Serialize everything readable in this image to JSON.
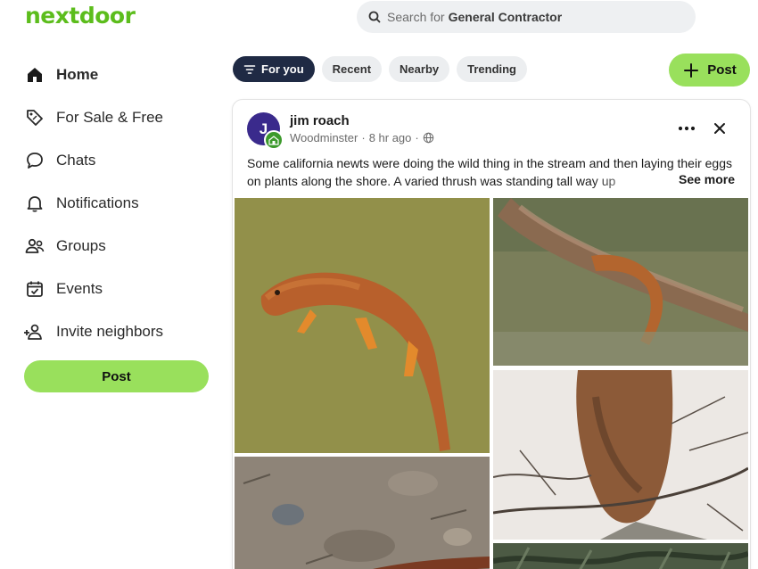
{
  "app": {
    "logo": "nextdoor",
    "brand_color": "#5cbd1c",
    "accent_color": "#99e05c"
  },
  "search": {
    "prefix": "Search for",
    "term": "General Contractor"
  },
  "sidebar": {
    "items": [
      {
        "label": "Home",
        "icon": "home-icon",
        "active": true
      },
      {
        "label": "For Sale & Free",
        "icon": "tag-icon"
      },
      {
        "label": "Chats",
        "icon": "chat-bubble-icon"
      },
      {
        "label": "Notifications",
        "icon": "bell-icon"
      },
      {
        "label": "Groups",
        "icon": "people-icon"
      },
      {
        "label": "Events",
        "icon": "calendar-icon"
      },
      {
        "label": "Invite neighbors",
        "icon": "add-person-icon"
      }
    ],
    "post_label": "Post"
  },
  "filters": {
    "tabs": [
      {
        "label": "For you",
        "icon": "filter-icon",
        "selected": true
      },
      {
        "label": "Recent"
      },
      {
        "label": "Nearby"
      },
      {
        "label": "Trending"
      }
    ]
  },
  "header": {
    "post_label": "Post"
  },
  "post": {
    "avatar_initial": "J",
    "avatar_color": "#3a2a8c",
    "author": "jim roach",
    "neighborhood": "Woodminster",
    "separator": "·",
    "time_ago": "8 hr ago",
    "visibility_icon": "globe-icon",
    "text": "Some california newts were doing the wild thing in the stream and then laying their eggs on plants along the shore. A varied thrush was standing tall way up",
    "see_more": "See more",
    "photos": [
      {
        "subject": "newt on olive background"
      },
      {
        "subject": "newt on branch"
      },
      {
        "subject": "bird on tree branch"
      },
      {
        "subject": "newt on rocky ground"
      },
      {
        "subject": "conifer foliage"
      }
    ]
  }
}
